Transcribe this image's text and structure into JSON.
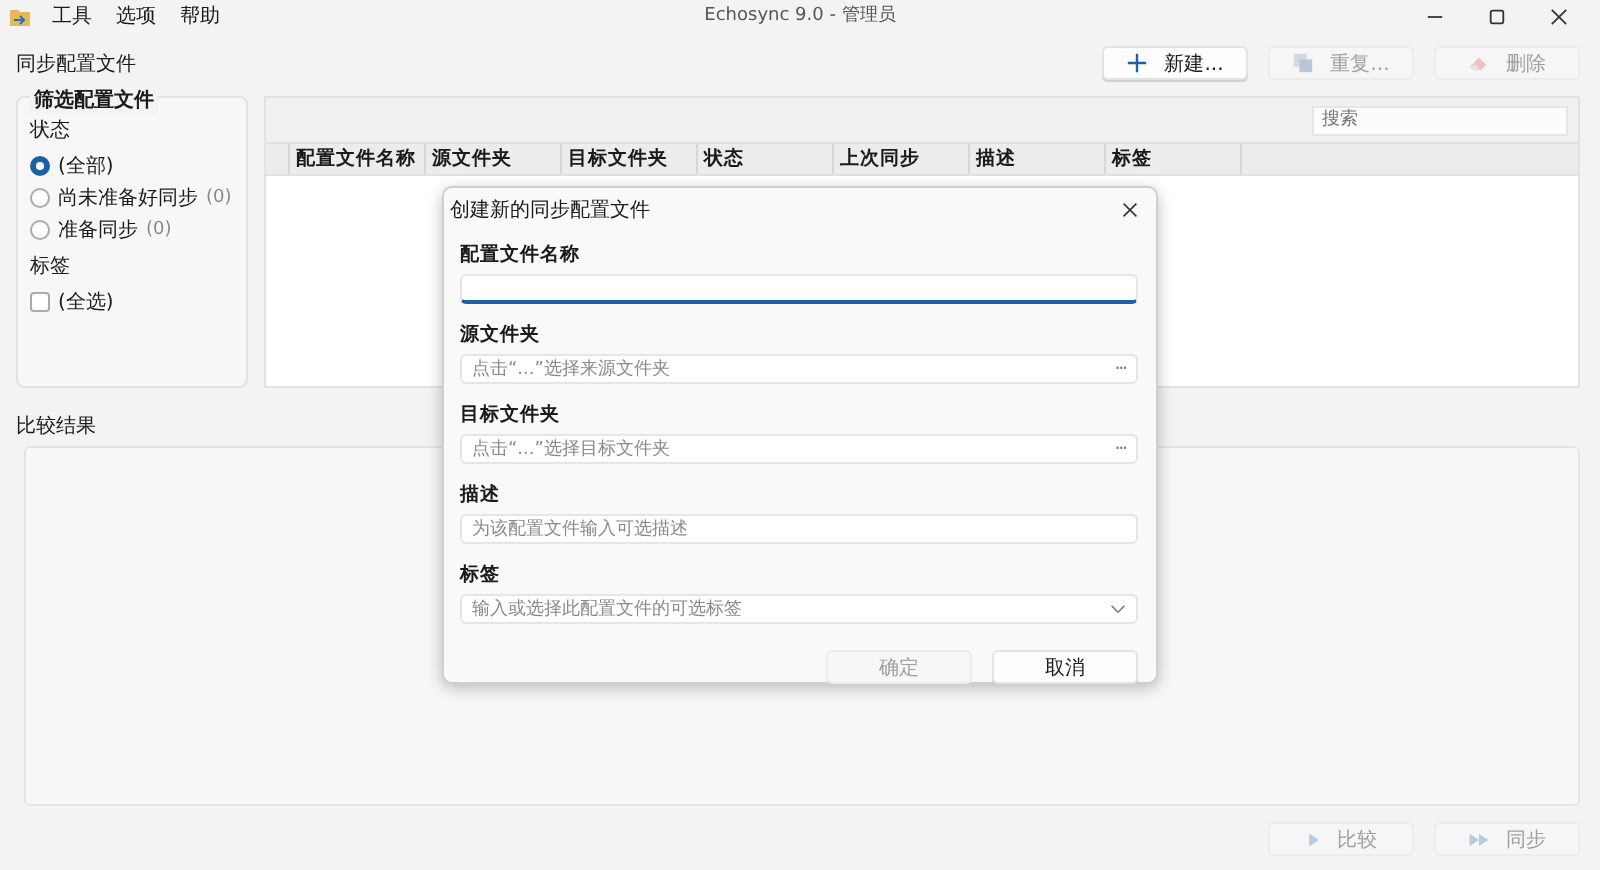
{
  "title_bar": {
    "menu": [
      "工具",
      "选项",
      "帮助"
    ],
    "title": "Echosync 9.0 - 管理员"
  },
  "profiles_section": {
    "heading": "同步配置文件",
    "toolbar": [
      {
        "label": "新建...",
        "kind": "new",
        "disabled": false
      },
      {
        "label": "重复...",
        "kind": "duplicate",
        "disabled": true
      },
      {
        "label": "删除",
        "kind": "delete",
        "disabled": true
      }
    ]
  },
  "filter": {
    "title": "筛选配置文件",
    "status_label": "状态",
    "status_options": [
      {
        "label": "(全部)",
        "selected": true
      },
      {
        "label": "尚未准备好同步",
        "count": "(0)",
        "selected": false
      },
      {
        "label": "准备同步",
        "count": "(0)",
        "selected": false
      }
    ],
    "tags_label": "标签",
    "tag_options": [
      {
        "label": "(全选)",
        "checked": false
      }
    ]
  },
  "table": {
    "search": {
      "placeholder": "搜索"
    },
    "columns": [
      "配置文件名称",
      "源文件夹",
      "目标文件夹",
      "状态",
      "上次同步",
      "描述",
      "标签"
    ]
  },
  "results": {
    "heading": "比较结果"
  },
  "actions": [
    {
      "label": "比较",
      "kind": "compare",
      "disabled": true
    },
    {
      "label": "同步",
      "kind": "sync",
      "disabled": true
    }
  ],
  "dialog": {
    "title": "创建新的同步配置文件",
    "fields": [
      {
        "label": "配置文件名称",
        "kind": "text",
        "focused": true
      },
      {
        "label": "源文件夹",
        "kind": "browse",
        "placeholder": "点击“...”选择来源文件夹",
        "browse_button": "···",
        "focused": false
      },
      {
        "label": "目标文件夹",
        "kind": "browse",
        "placeholder": "点击“...”选择目标文件夹",
        "browse_button": "···",
        "focused": false
      },
      {
        "label": "描述",
        "kind": "text",
        "placeholder": "为该配置文件输入可选描述",
        "focused": false
      },
      {
        "label": "标签",
        "kind": "combo",
        "placeholder": "输入或选择此配置文件的可选标签",
        "focused": false
      }
    ],
    "buttons": [
      {
        "label": "确定",
        "disabled": true
      },
      {
        "label": "取消",
        "disabled": false
      }
    ]
  }
}
